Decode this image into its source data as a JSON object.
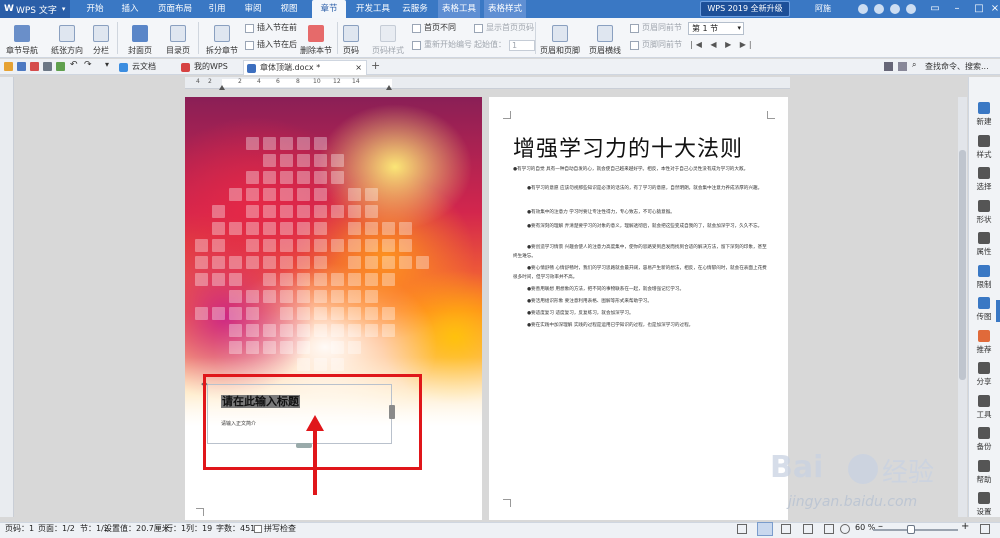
{
  "app": {
    "name": "WPS 文字",
    "upgrade": "WPS 2019 全新升级",
    "user": "阿施"
  },
  "menu": [
    "开始",
    "插入",
    "页面布局",
    "引用",
    "审阅",
    "视图",
    "章节",
    "开发工具",
    "云服务",
    "表格工具",
    "表格样式"
  ],
  "ribbon": {
    "chapter_nav": "章节导航",
    "paper_dir": "纸张方向",
    "columns": "分栏",
    "cover": "封面页",
    "toc": "目录页",
    "split_chapter": "拆分章节",
    "insert_before": "插入节在前",
    "insert_after": "插入节在后",
    "delete_section": "删除本节",
    "page_num": "页码",
    "page_num_style": "页码样式",
    "first_diff": "首页不同",
    "show_first_num": "显示首页页码",
    "restart_num": "重新开始编号",
    "start_val_label": "起始值：",
    "start_val": "1",
    "header_footer": "页眉和页脚",
    "header_line": "页眉横线",
    "same_prev_header": "页眉同前节",
    "same_prev_footer": "页脚同前节",
    "section_select": "第 1 节"
  },
  "tabs": [
    {
      "label": "云文档",
      "active": false
    },
    {
      "label": "我的WPS",
      "active": false
    },
    {
      "label": "章体顶端.docx *",
      "active": true
    }
  ],
  "search_cmd": "查找命令、搜索...",
  "ruler": [
    "4",
    "2",
    "2",
    "4",
    "6",
    "8",
    "10",
    "12",
    "14"
  ],
  "page1": {
    "title_placeholder": "请在此输入标题",
    "subtitle_placeholder": "请输入正文简介"
  },
  "page2": {
    "title": "增强学习力的十大法则",
    "paragraphs": [
      "●有学习的自觉 具有一种自动自发的心，就会使自己越来越好学。相反，本性对于自己心灵性没有成为学习的大敌。",
      "●有学习的意愿 应该勿视那些知识是必须的话法的，有了学习的意愿，自然明朗，就会集中注意力养成浓厚的兴趣。",
      "●有效集中的注意力 学习时要让专注性得力，专心致志，不可心猿意猴。",
      "●要有深刻的理解 弄清楚要学习的对象的意义，理解透彻后，就会把这些变成自我的了，就会加深学习，久久不忘。",
      "●要创造学习情景 兴趣会使人的注意力高度集中，使你的思路受到启发而找到合适的解决方法，留下深刻的印象，甚至终生难忘。",
      "●要心情舒畅 心情舒畅时，我们的学习思路就会最开阔，容易产生新的想法，相反，在心情郁闷时，就会在表面上花费很多时间，但学习效率并不高。",
      "●要善用联想 用想象的方法，把不同的事物联系在一起，就会增强记忆学习。",
      "●要活用组识形象 要注意利用表格、图解等形式来帮助学习。",
      "●要适度复习 适度复习，反复练习，就会加深学习。",
      "●要在实践中加深理解 实践的过程是运用已学知识的过程，也是加深学习的过程。"
    ]
  },
  "right_panel": [
    "新建",
    "样式",
    "选择",
    "形状",
    "属性",
    "限制",
    "传图",
    "推荐",
    "分享",
    "工具",
    "备份",
    "帮助",
    "设置"
  ],
  "status": {
    "page": "页码：1",
    "pages": "页面：1/2",
    "section": "节：1/2",
    "setting": "设置值：20.7厘米",
    "row": "行：1",
    "col": "列：19",
    "words": "字数：451",
    "spell": "拼写检查",
    "zoom": "60 %"
  },
  "watermark": {
    "brand": "Bai",
    "brand_cn": "经验",
    "url": "jingyan.baidu.com"
  }
}
